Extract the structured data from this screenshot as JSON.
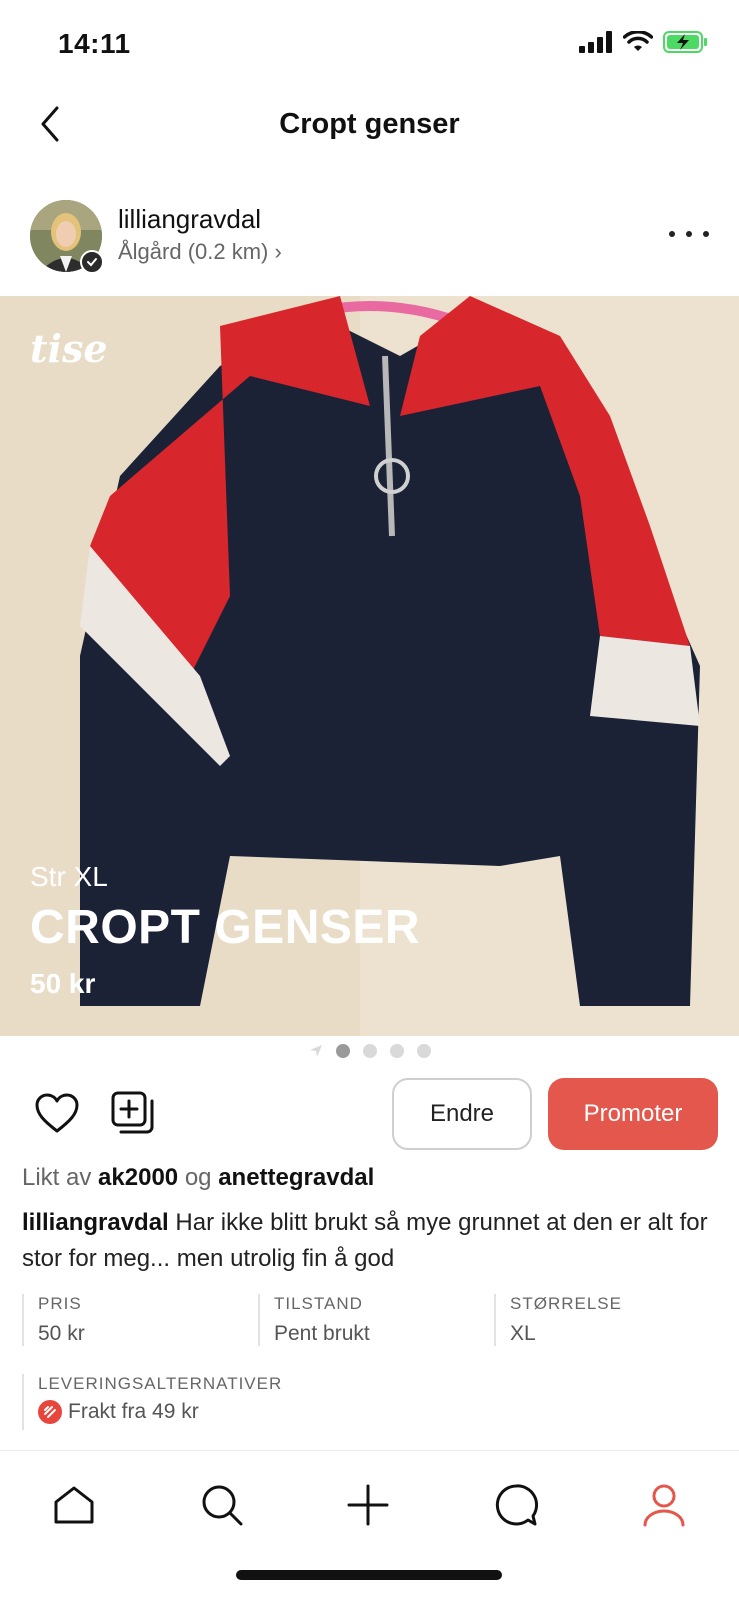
{
  "status_bar": {
    "time": "14:11",
    "icons": [
      "signal-icon",
      "wifi-icon",
      "battery-charging-icon"
    ],
    "battery_color": "#4cd964"
  },
  "header": {
    "back_icon": "chevron-left-icon",
    "title": "Cropt genser"
  },
  "seller": {
    "username": "lilliangravdal",
    "location": "Ålgård (0.2 km) ›",
    "verified_icon": "checkmark-icon",
    "more_icon": "more-horizontal-icon"
  },
  "listing_image": {
    "watermark": "tise",
    "size_label": "Str XL",
    "title": "CROPT GENSER",
    "price": "50 kr",
    "pager": {
      "total_dots": 4,
      "active_index": 0,
      "lead_icon": "location-arrow-icon"
    }
  },
  "actions": {
    "like_icon": "heart-icon",
    "collection_icon": "add-to-collection-icon",
    "edit_label": "Endre",
    "promote_label": "Promoter",
    "promote_color": "#e4574c"
  },
  "likes": {
    "prefix": "Likt av",
    "user1": "ak2000",
    "joiner": "og",
    "user2": "anettegravdal"
  },
  "description": {
    "author": "lilliangravdal",
    "text": "Har ikke blitt brukt så mye grunnet at den er alt for stor for meg... men utrolig fin å god"
  },
  "details": {
    "price": {
      "label": "PRIS",
      "value": "50 kr"
    },
    "condition": {
      "label": "TILSTAND",
      "value": "Pent brukt"
    },
    "size": {
      "label": "STØRRELSE",
      "value": "XL"
    }
  },
  "delivery": {
    "label": "LEVERINGSALTERNATIVER",
    "value": "Frakt fra 49 kr",
    "icon": "shipping-icon",
    "icon_color": "#e8453c"
  },
  "tabbar": {
    "items": [
      "home-icon",
      "search-icon",
      "plus-icon",
      "chat-icon",
      "profile-icon"
    ],
    "active_color": "#e4574c"
  }
}
